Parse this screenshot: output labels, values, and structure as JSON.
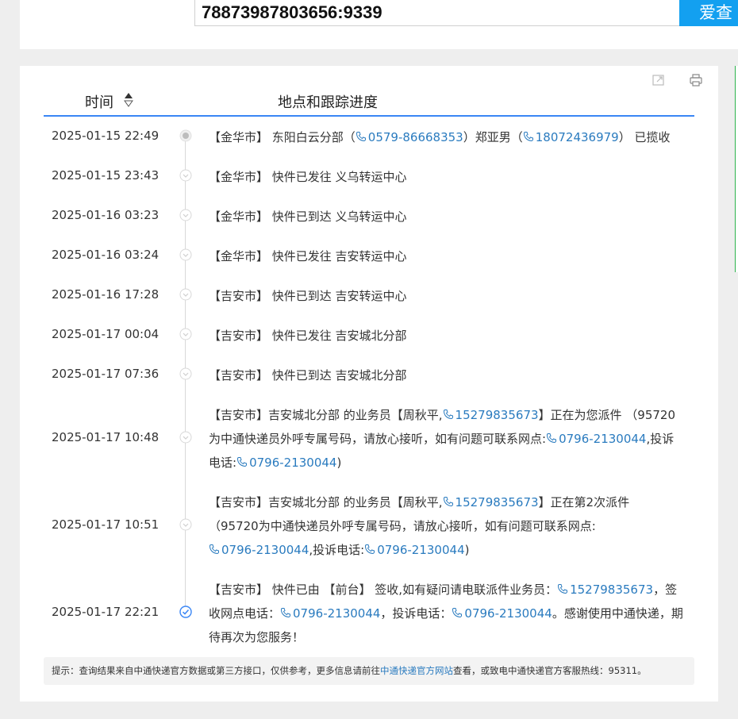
{
  "search": {
    "value": "78873987803656:9339",
    "button_label": "爱查"
  },
  "table": {
    "header_time": "时间",
    "header_progress": "地点和跟踪进度"
  },
  "rows": [
    {
      "time": "2025-01-15 22:49",
      "parts": [
        {
          "t": "text",
          "v": "【金华市】 东阳白云分部（"
        },
        {
          "t": "phone",
          "v": "0579-86668353"
        },
        {
          "t": "text",
          "v": "）郑亚男（"
        },
        {
          "t": "phone",
          "v": "18072436979"
        },
        {
          "t": "text",
          "v": "） 已揽收"
        }
      ]
    },
    {
      "time": "2025-01-15 23:43",
      "parts": [
        {
          "t": "text",
          "v": "【金华市】 快件已发往 义乌转运中心"
        }
      ]
    },
    {
      "time": "2025-01-16 03:23",
      "parts": [
        {
          "t": "text",
          "v": "【金华市】 快件已到达 义乌转运中心"
        }
      ]
    },
    {
      "time": "2025-01-16 03:24",
      "parts": [
        {
          "t": "text",
          "v": "【金华市】 快件已发往 吉安转运中心"
        }
      ]
    },
    {
      "time": "2025-01-16 17:28",
      "parts": [
        {
          "t": "text",
          "v": "【吉安市】 快件已到达 吉安转运中心"
        }
      ]
    },
    {
      "time": "2025-01-17 00:04",
      "parts": [
        {
          "t": "text",
          "v": "【吉安市】 快件已发往 吉安城北分部"
        }
      ]
    },
    {
      "time": "2025-01-17 07:36",
      "parts": [
        {
          "t": "text",
          "v": "【吉安市】 快件已到达 吉安城北分部"
        }
      ]
    },
    {
      "time": "2025-01-17 10:48",
      "parts": [
        {
          "t": "text",
          "v": "【吉安市】吉安城北分部 的业务员【周秋平,"
        },
        {
          "t": "phone",
          "v": "15279835673"
        },
        {
          "t": "text",
          "v": "】正在为您派件 （95720为中通快递员外呼专属号码，请放心接听，如有问题可联系网点:"
        },
        {
          "t": "phone",
          "v": "0796-2130044"
        },
        {
          "t": "text",
          "v": ",投诉电话:"
        },
        {
          "t": "phone",
          "v": "0796-2130044"
        },
        {
          "t": "text",
          "v": ")"
        }
      ]
    },
    {
      "time": "2025-01-17 10:51",
      "parts": [
        {
          "t": "text",
          "v": "【吉安市】吉安城北分部 的业务员【周秋平,"
        },
        {
          "t": "phone",
          "v": "15279835673"
        },
        {
          "t": "text",
          "v": "】正在第2次派件 （95720为中通快递员外呼专属号码，请放心接听，如有问题可联系网点:"
        },
        {
          "t": "phone",
          "v": "0796-2130044"
        },
        {
          "t": "text",
          "v": ",投诉电话:"
        },
        {
          "t": "phone",
          "v": "0796-2130044"
        },
        {
          "t": "text",
          "v": ")"
        }
      ]
    },
    {
      "time": "2025-01-17 22:21",
      "parts": [
        {
          "t": "text",
          "v": "【吉安市】 快件已由 【前台】 签收,如有疑问请电联派件业务员："
        },
        {
          "t": "phone",
          "v": "15279835673"
        },
        {
          "t": "text",
          "v": "，签收网点电话："
        },
        {
          "t": "phone",
          "v": "0796-2130044"
        },
        {
          "t": "text",
          "v": "，投诉电话："
        },
        {
          "t": "phone",
          "v": "0796-2130044"
        },
        {
          "t": "text",
          "v": "。感谢使用中通快递，期待再次为您服务！"
        }
      ]
    }
  ],
  "footer": {
    "prefix": "提示：查询结果来自中通快递官方数据或第三方接口，仅供参考，更多信息请前往",
    "link": "中通快递官方网站",
    "suffix": "查看，或致电中通快递官方客服热线：95311。"
  },
  "colors": {
    "accent": "#13a0f0",
    "link": "#2a7bbf",
    "header_rule": "#3a86f5"
  }
}
